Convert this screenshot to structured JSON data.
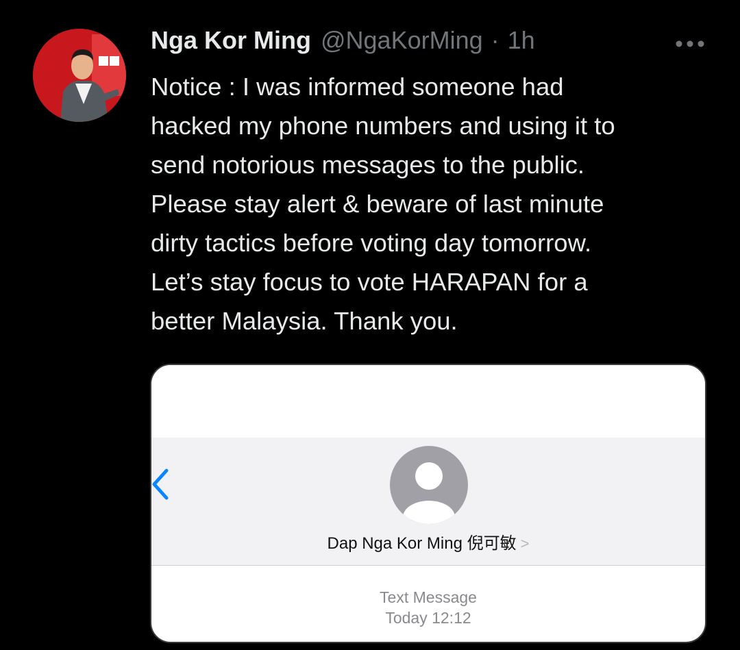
{
  "tweet": {
    "author": {
      "display_name": "Nga Kor Ming",
      "handle": "@NgaKorMing",
      "avatar_icon": "profile-photo"
    },
    "separator": "·",
    "time": "1h",
    "more_icon": "more-horizontal-icon",
    "text_lines": [
      "Notice : I was informed someone had",
      "hacked my phone numbers and using it to",
      "send notorious messages to the public.",
      "Please stay alert & beware of last minute",
      "dirty tactics before voting day tomorrow.",
      "Let’s stay focus to vote HARAPAN for a",
      "better Malaysia. Thank you."
    ],
    "media": {
      "contact_name": "Dap Nga Kor Ming 倪可敏",
      "chevron": ">",
      "meta_type": "Text Message",
      "meta_time": "Today 12:12",
      "back_icon": "back-chevron-icon",
      "contact_icon": "person-placeholder-icon"
    }
  },
  "colors": {
    "background": "#000000",
    "primary_text": "#e7e9ea",
    "secondary_text": "#71767b",
    "ios_blue": "#0a84ff",
    "ios_gray": "#a0a0a6"
  }
}
